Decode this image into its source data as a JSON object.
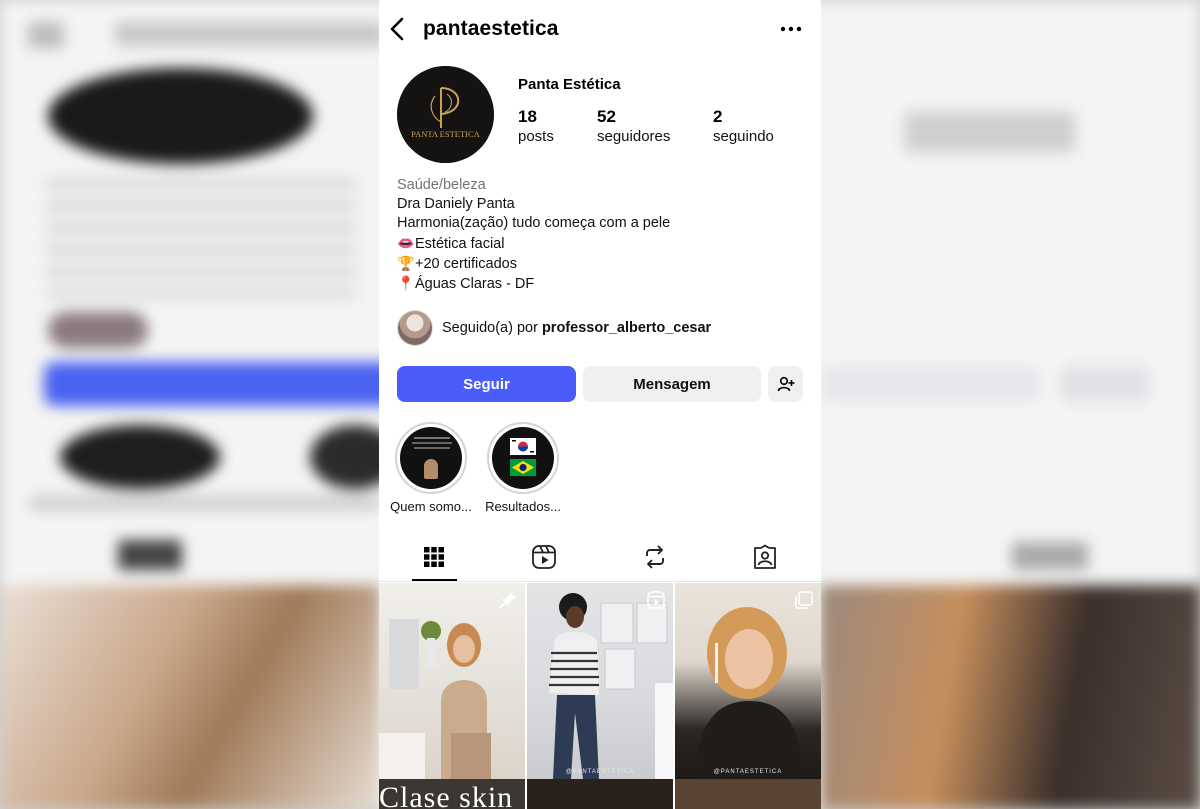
{
  "profile": {
    "username": "pantaestetica",
    "display_name": "Panta Estética",
    "avatar_text": "PANTA ESTETICA",
    "stats": {
      "posts_count": "18",
      "posts_label": "posts",
      "followers_count": "52",
      "followers_label": "seguidores",
      "following_count": "2",
      "following_label": "seguindo"
    },
    "bio": {
      "category": "Saúde/beleza",
      "line1": "Dra Daniely Panta",
      "line2": "Harmonia(zação) tudo começa com a pele",
      "line3_emoji": "👄",
      "line3": "Estética facial",
      "line4_emoji": "🏆",
      "line4": "+20 certificados",
      "line5_emoji": "📍",
      "line5": "Águas Claras - DF"
    },
    "followed_by": {
      "prefix": "Seguido(a) por",
      "user": "professor_alberto_cesar"
    }
  },
  "actions": {
    "follow_label": "Seguir",
    "message_label": "Mensagem",
    "add_user_icon": "add-user-icon"
  },
  "highlights": [
    {
      "label": "Quem somo..."
    },
    {
      "label": "Resultados..."
    }
  ],
  "tabs": [
    {
      "icon": "grid-icon",
      "active": true
    },
    {
      "icon": "reels-icon",
      "active": false
    },
    {
      "icon": "reposts-icon",
      "active": false
    },
    {
      "icon": "tagged-icon",
      "active": false
    }
  ],
  "posts": [
    {
      "overlay_icon": "pin-icon",
      "bottom_caption": "Clase skin"
    },
    {
      "overlay_icon": "reels-icon",
      "watermark": "@PANTAESTETICA"
    },
    {
      "overlay_icon": "carousel-icon",
      "watermark": "@PANTAESTETICA"
    }
  ],
  "colors": {
    "primary_button": "#4a5df9",
    "secondary_button": "#efefef",
    "muted_text": "#737373"
  }
}
